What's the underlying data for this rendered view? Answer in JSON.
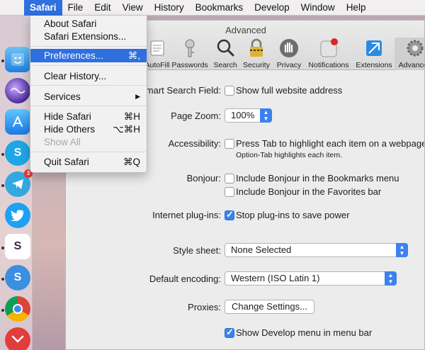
{
  "menubar": {
    "apple_glyph": "",
    "items": [
      "Safari",
      "File",
      "Edit",
      "View",
      "History",
      "Bookmarks",
      "Develop",
      "Window",
      "Help"
    ]
  },
  "safari_menu": {
    "about": "About Safari",
    "extensions": "Safari Extensions...",
    "preferences": "Preferences...",
    "preferences_shortcut": "⌘,",
    "clear_history": "Clear History...",
    "services": "Services",
    "services_arrow": "▶",
    "hide_safari": "Hide Safari",
    "hide_safari_shortcut": "⌘H",
    "hide_others": "Hide Others",
    "hide_others_shortcut": "⌥⌘H",
    "show_all": "Show All",
    "quit": "Quit Safari",
    "quit_shortcut": "⌘Q"
  },
  "window": {
    "title": "Advanced",
    "toolbar": [
      "AutoFill",
      "Passwords",
      "Search",
      "Security",
      "Privacy",
      "Notifications",
      "Extensions",
      "Advanced"
    ]
  },
  "prefs": {
    "smart_search_label": "Smart Search Field:",
    "smart_search_option": "Show full website address",
    "page_zoom_label": "Page Zoom:",
    "page_zoom_value": "100%",
    "accessibility_label": "Accessibility:",
    "accessibility_option": "Press Tab to highlight each item on a webpage",
    "accessibility_hint": "Option-Tab highlights each item.",
    "bonjour_label": "Bonjour:",
    "bonjour_bookmarks": "Include Bonjour in the Bookmarks menu",
    "bonjour_favorites": "Include Bonjour in the Favorites bar",
    "plugins_label": "Internet plug-ins:",
    "plugins_option": "Stop plug-ins to save power",
    "stylesheet_label": "Style sheet:",
    "stylesheet_value": "None Selected",
    "encoding_label": "Default encoding:",
    "encoding_value": "Western (ISO Latin 1)",
    "proxies_label": "Proxies:",
    "proxies_button": "Change Settings...",
    "develop_option": "Show Develop menu in menu bar"
  },
  "dock": {
    "telegram_badge": "3",
    "skype_letter": "S",
    "slack_letter": "S",
    "simplenote_letter": "S"
  },
  "colors": {
    "accent": "#2f6fde",
    "checkbox_blue": "#3b82f0"
  }
}
